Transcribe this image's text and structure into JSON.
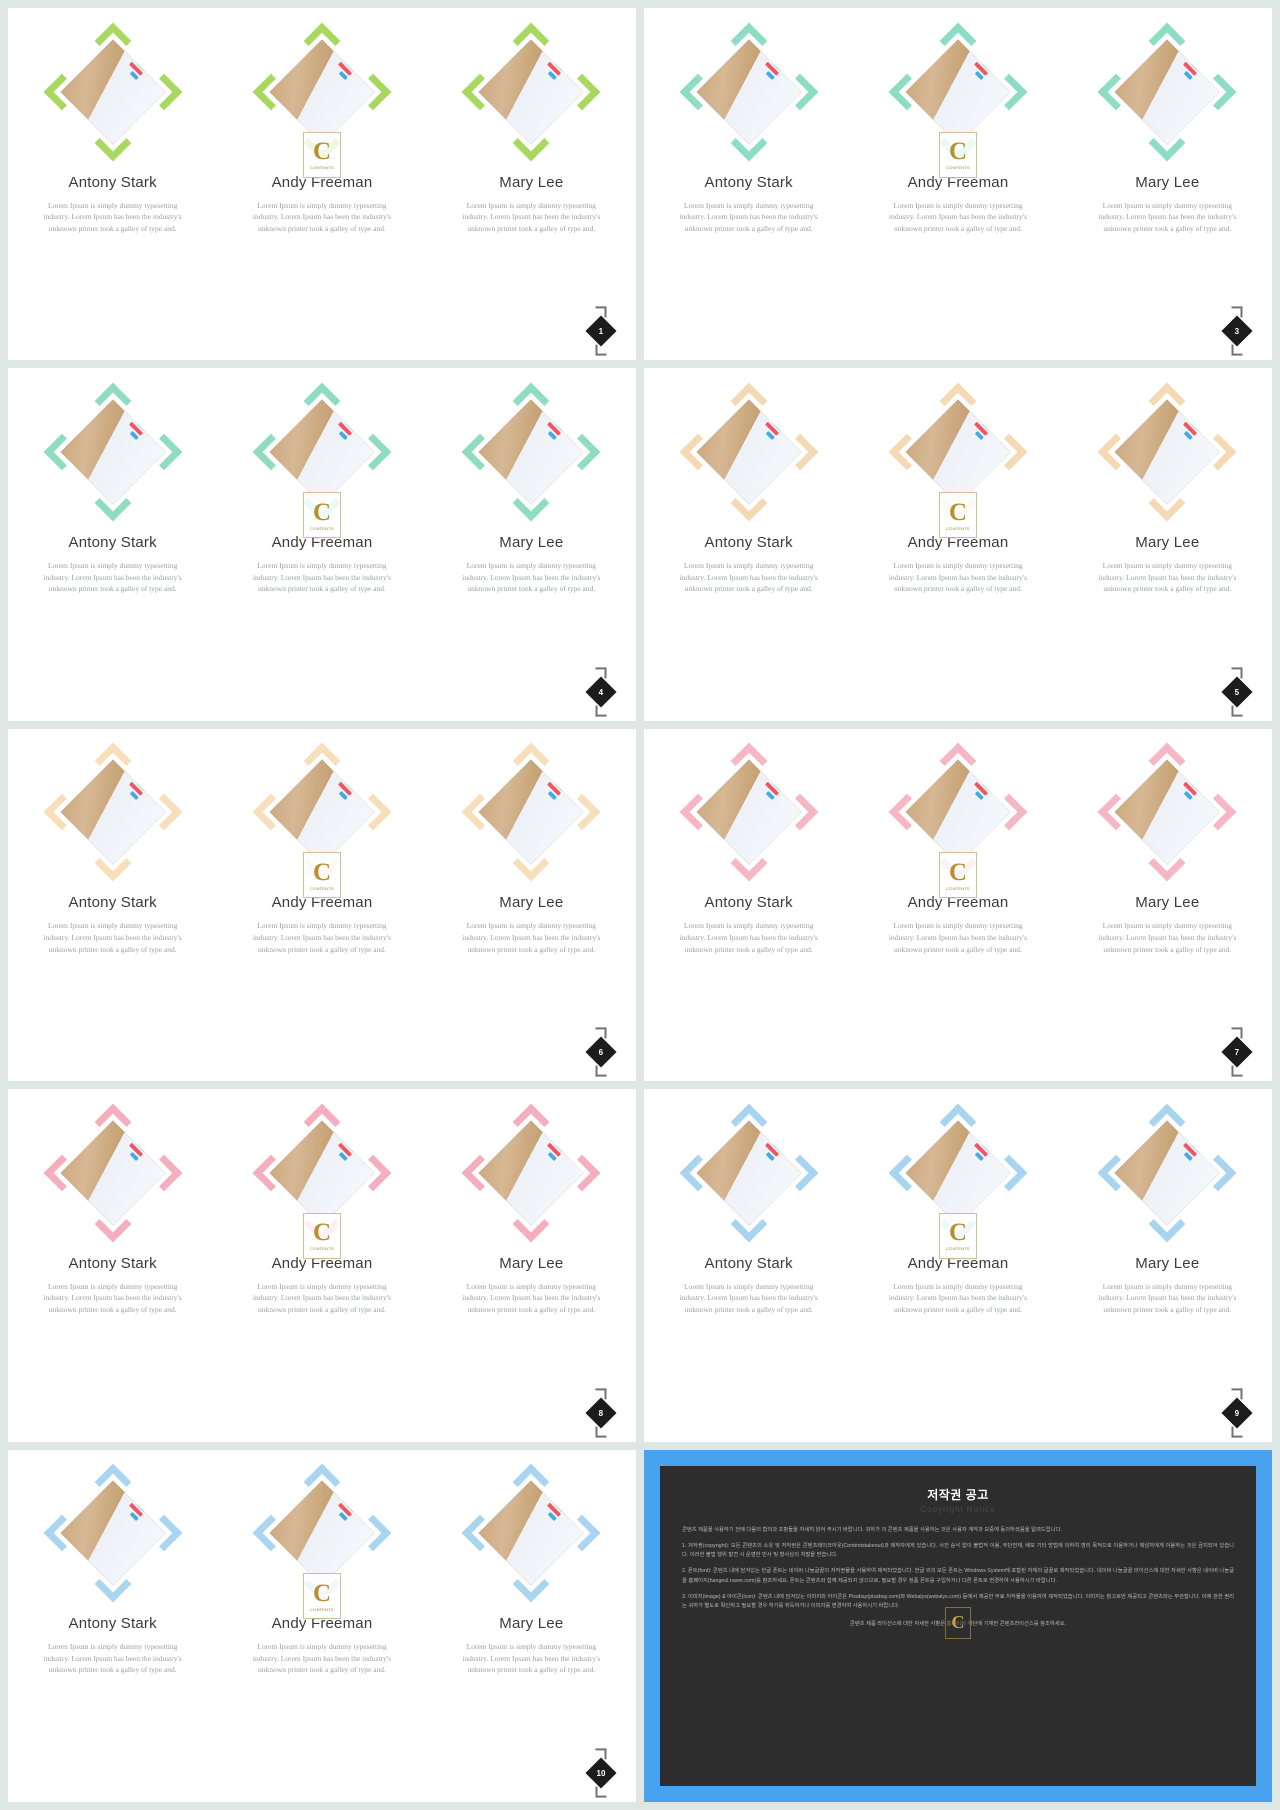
{
  "deck": {
    "member_names": [
      "Antony Stark",
      "Andy Freeman",
      "Mary Lee"
    ],
    "member_desc": "Lorem Ipsum is simply dummy typesetting industry. Lorem Ipsum has been the industry's unknown printer took a galley of type and.",
    "watermark": {
      "letter": "C",
      "sub": "CONTENTS"
    }
  },
  "slides": [
    {
      "page": "1",
      "accent": "#a8d860",
      "accent_name": "lime-green"
    },
    {
      "page": "3",
      "accent": "#8ddcc4",
      "accent_name": "mint-green"
    },
    {
      "page": "4",
      "accent": "#8fdcc0",
      "accent_name": "mint-green"
    },
    {
      "page": "5",
      "accent": "#f4d9b4",
      "accent_name": "peach-cream"
    },
    {
      "page": "6",
      "accent": "#f6dfba",
      "accent_name": "cream-tan"
    },
    {
      "page": "7",
      "accent": "#f6b7c4",
      "accent_name": "soft-pink"
    },
    {
      "page": "8",
      "accent": "#f4aebd",
      "accent_name": "soft-pink"
    },
    {
      "page": "9",
      "accent": "#a8d4ef",
      "accent_name": "sky-blue"
    },
    {
      "page": "10",
      "accent": "#a9d5f0",
      "accent_name": "sky-blue"
    }
  ],
  "copyright": {
    "title": "저작권 공고",
    "subtitle": "Copyright Notice",
    "intro": "콘텐츠 제품을 사용하기 전에 다음의 합의과 조항들을 자세히 읽어 주시기 바랍니다. 귀하가 이 콘텐츠 제품을 사용하는 것은 사용자 계약과 보증에 동의하셨음을 알려드립니다.",
    "items": [
      "1. 저작권(copyright): 모든 콘텐츠의 소유 및 저작권은 콘텐츠테이크아웃(Contentstakeout)과 제작자에게 있습니다. 사진 승낙 없이 불법적 이용, 무단전재, 배포 기타 방법에 의하여 영리 목적으로 이용하거나 제삼자에게 이용하는 것은 금지되어 있습니다. 이러한 불법 행위 발견 시 운영한 민사 및 형사상의 처벌을 받습니다.",
      "2. 폰트(font): 콘텐츠 내에 담겨있는 한글 폰트는 네이버 나눔글꼴의 저작권물을 사용하여 제작되었습니다. 한글 외의 모든 폰트는 Windows System에 포함된 자체의 글꼴로 제작되었습니다. 네이버 나눔글꼴 라이선스에 대한 자세한 사항은 네이버 나눔글꼴 홈페이지(hangeul.naver.com)를 참조하세요. 폰트는 콘텐츠와 함께 제공되지 않으므로, 필요할 경우 정품 폰트를 구입하거나 다른 폰트로 변경하여 사용하시기 바랍니다.",
      "3. 이미지(image) & 아이콘(icon): 콘텐츠 내에 담겨있는 이미지와 아이콘은 Pixabay(pixabay.com)와 Webalys(webalys.com) 등에서 제공한 무료 저작물을 이용하여 제작되었습니다. 이미지는 참고로만 제공되고 콘텐츠와는 무관합니다. 이에 관한 권리는 귀하가 별도로 확인하고 필요할 경우 허가를 취득하거나 이미지를 변경하여 사용하시기 바랍니다."
    ],
    "footer": "콘텐츠 제품 라이선스에 대한 자세한 사항은 홈페이지 하단에 기재한 콘텐츠라이선스를 참조하세요."
  }
}
